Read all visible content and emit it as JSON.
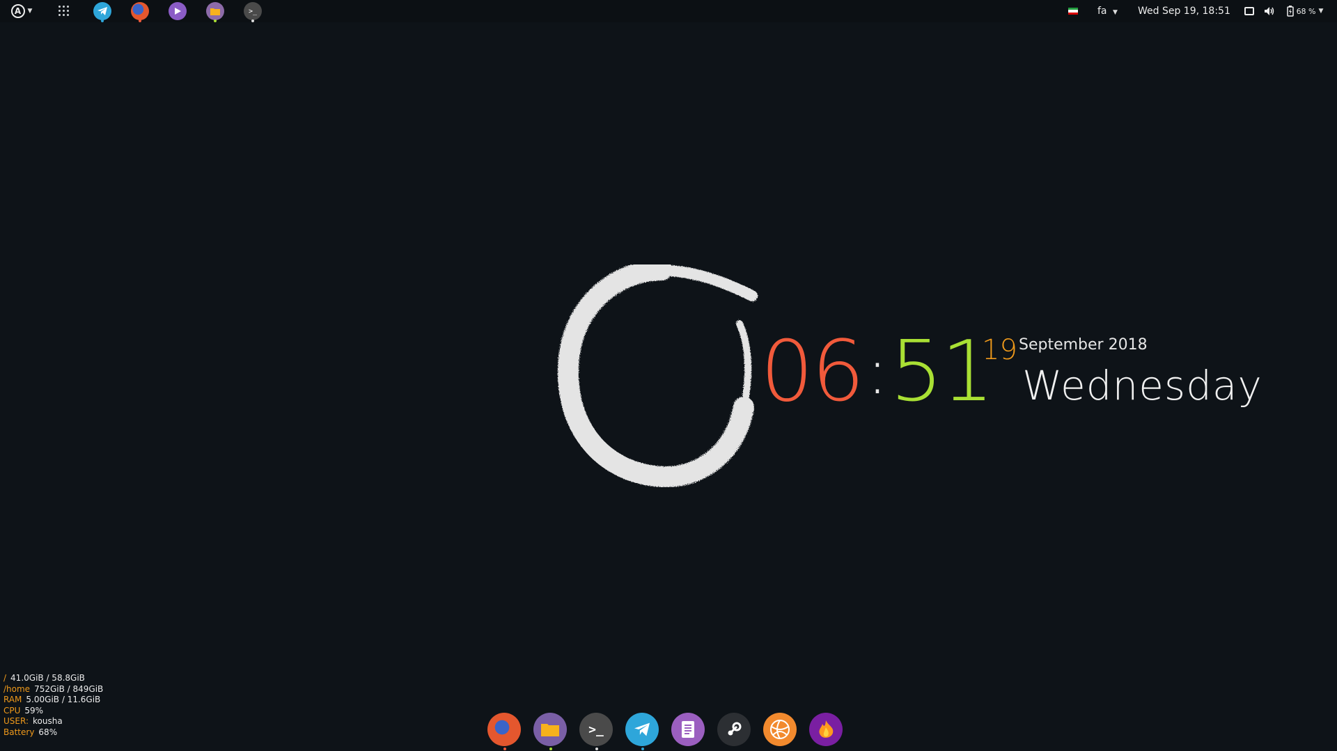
{
  "top_panel": {
    "keyboard_layout": "fa",
    "datetime": "Wed Sep 19, 18:51",
    "battery_percent": "68 %",
    "pinned_apps": [
      {
        "icon": "telegram-icon",
        "color": "#2ea6da"
      },
      {
        "icon": "firefox-icon",
        "color": "#e4572e"
      },
      {
        "icon": "media-player-icon",
        "color": "#8b5cc6"
      },
      {
        "icon": "files-icon",
        "color": "#8d6ba8"
      },
      {
        "icon": "terminal-icon",
        "color": "#4a4a4a"
      }
    ]
  },
  "clock": {
    "hours": "06",
    "separator": ":",
    "minutes": "51",
    "day": "19",
    "month_year": "September 2018",
    "weekday": "Wednesday",
    "colors": {
      "hours": "#f15a3b",
      "minutes": "#a9e034",
      "day": "#f09a1b"
    }
  },
  "sysinfo": [
    {
      "label": "/",
      "value": "41.0GiB / 58.8GiB"
    },
    {
      "label": "/home",
      "value": "752GiB / 849GiB"
    },
    {
      "label": "RAM",
      "value": "5.00GiB / 11.6GiB"
    },
    {
      "label": "CPU",
      "value": "59%"
    },
    {
      "label": "USER:",
      "value": "kousha"
    },
    {
      "label": "Battery",
      "value": "68%"
    }
  ],
  "dock": [
    {
      "icon": "firefox-icon",
      "color": "#e4572e",
      "running_color": "#f15a3b"
    },
    {
      "icon": "files-icon",
      "color": "#7a5fa6",
      "running_color": "#a9e034"
    },
    {
      "icon": "terminal-icon",
      "color": "#4a4a4a",
      "running_color": "#dddddd"
    },
    {
      "icon": "telegram-icon",
      "color": "#2ea6da",
      "running_color": "#2ea6da"
    },
    {
      "icon": "text-editor-icon",
      "color": "#9b5fc0",
      "running_color": ""
    },
    {
      "icon": "steam-icon",
      "color": "#2c2f33",
      "running_color": ""
    },
    {
      "icon": "web-browser-icon",
      "color": "#f28a2e",
      "running_color": ""
    },
    {
      "icon": "firefox-nightly-icon",
      "color": "#7a1fa2",
      "running_color": ""
    }
  ]
}
